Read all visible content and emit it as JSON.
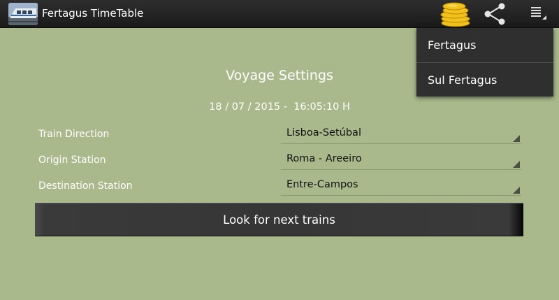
{
  "app": {
    "title": "Fertagus TimeTable",
    "icons": {
      "app_icon": "train-icon",
      "donate": "coins-icon",
      "share": "share-icon",
      "overflow": "overflow-menu-icon"
    }
  },
  "menu": {
    "items": [
      {
        "label": "Fertagus"
      },
      {
        "label": "Sul Fertagus"
      }
    ]
  },
  "screen": {
    "title": "Voyage Settings",
    "datetime": "18 / 07 / 2015 -  16:05:10 H"
  },
  "form": {
    "train_direction": {
      "label": "Train Direction",
      "value": "Lisboa-Setúbal"
    },
    "origin_station": {
      "label": "Origin Station",
      "value": "Roma - Areeiro"
    },
    "destination_station": {
      "label": "Destination Station",
      "value": "Entre-Campos"
    }
  },
  "actions": {
    "search_label": "Look for next trains"
  },
  "colors": {
    "background": "#aab98c",
    "actionbar": "#222222",
    "menu": "#2f2f2f",
    "button": "#363636",
    "coin": "#f2c21a"
  }
}
